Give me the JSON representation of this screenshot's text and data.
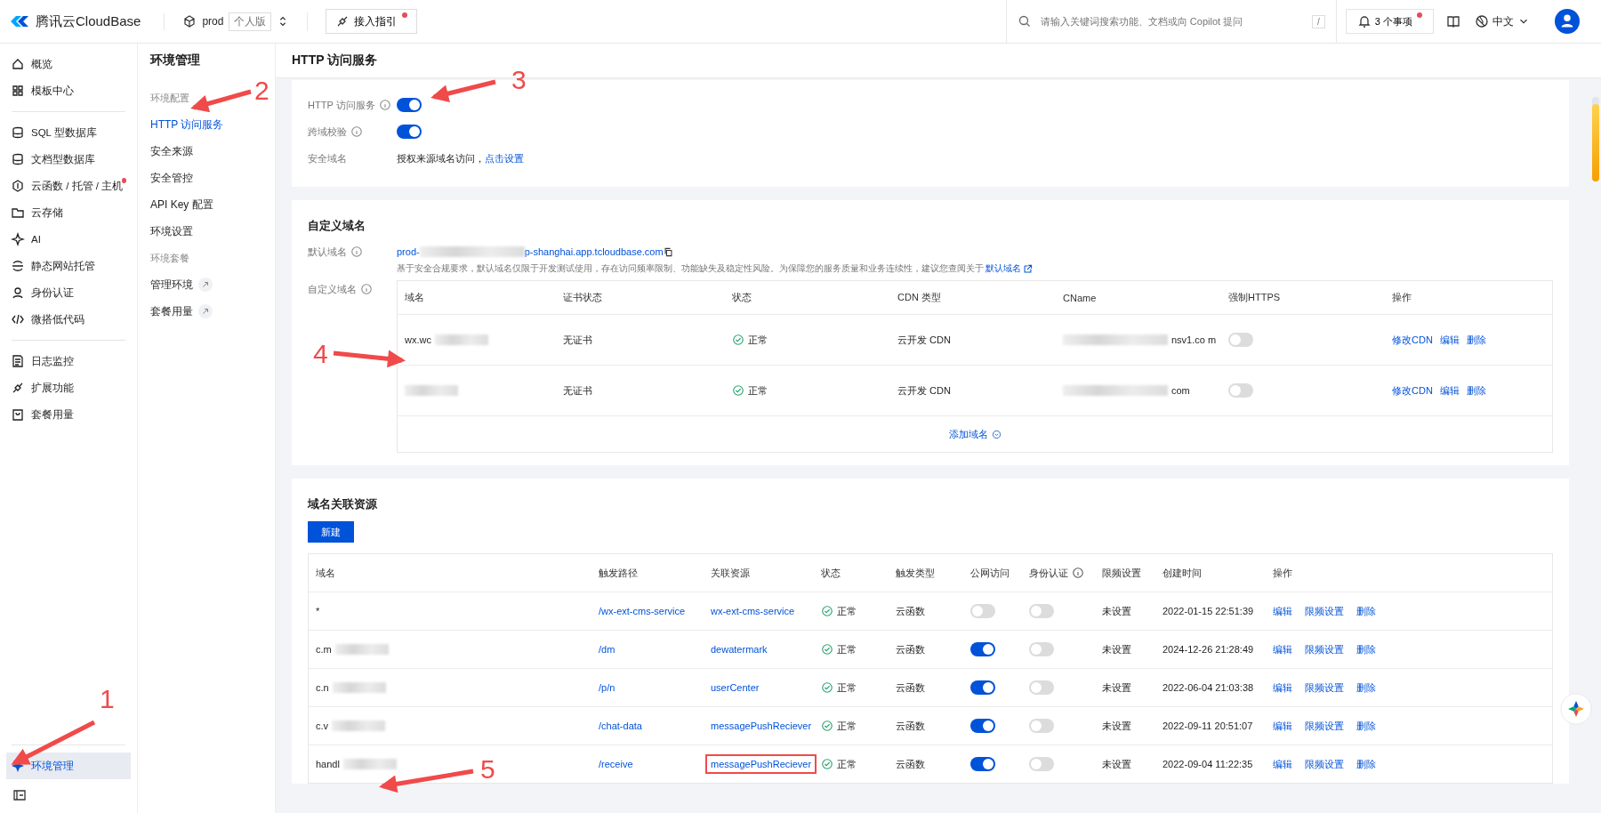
{
  "topbar": {
    "brand": "腾讯云CloudBase",
    "env": "prod",
    "plan": "个人版",
    "guide": "接入指引",
    "search": {
      "placeholder": "请输入关键词搜索功能、文档或向 Copilot 提问",
      "shortcut": "/"
    },
    "notices": "3 个事项",
    "language": "中文"
  },
  "sidebar": {
    "groups": [
      {
        "items": [
          {
            "label": "概览",
            "selected": false,
            "dot": false
          },
          {
            "label": "模板中心",
            "selected": false,
            "dot": false
          }
        ]
      },
      {
        "items": [
          {
            "label": "SQL 型数据库",
            "selected": false,
            "dot": false
          },
          {
            "label": "文档型数据库",
            "selected": false,
            "dot": false
          },
          {
            "label": "云函数 / 托管 / 主机",
            "selected": false,
            "dot": true
          },
          {
            "label": "云存储",
            "selected": false,
            "dot": false
          },
          {
            "label": "AI",
            "selected": false,
            "dot": false
          },
          {
            "label": "静态网站托管",
            "selected": false,
            "dot": false
          },
          {
            "label": "身份认证",
            "selected": false,
            "dot": false
          },
          {
            "label": "微搭低代码",
            "selected": false,
            "dot": false
          }
        ]
      },
      {
        "items": [
          {
            "label": "日志监控",
            "selected": false,
            "dot": false
          },
          {
            "label": "扩展功能",
            "selected": false,
            "dot": false
          },
          {
            "label": "套餐用量",
            "selected": false,
            "dot": false
          }
        ]
      }
    ],
    "footer": {
      "label": "环境管理",
      "selected": true
    }
  },
  "subnav": {
    "title": "环境管理",
    "items": [
      {
        "kind": "heading",
        "label": "环境配置"
      },
      {
        "kind": "link",
        "label": "HTTP 访问服务",
        "selected": true,
        "external": false
      },
      {
        "kind": "link",
        "label": "安全来源",
        "selected": false,
        "external": false
      },
      {
        "kind": "link",
        "label": "安全管控",
        "selected": false,
        "external": false
      },
      {
        "kind": "link",
        "label": "API Key 配置",
        "selected": false,
        "external": false
      },
      {
        "kind": "link",
        "label": "环境设置",
        "selected": false,
        "external": false
      },
      {
        "kind": "heading",
        "label": "环境套餐"
      },
      {
        "kind": "link",
        "label": "管理环境",
        "selected": false,
        "external": true
      },
      {
        "kind": "link",
        "label": "套餐用量",
        "selected": false,
        "external": true
      }
    ]
  },
  "page_title": "HTTP 访问服务",
  "http_settings": [
    {
      "kind": "toggle",
      "label": "HTTP 访问服务",
      "info": true,
      "on": true
    },
    {
      "kind": "toggle",
      "label": "跨域校验",
      "info": true,
      "on": true
    },
    {
      "kind": "text",
      "label": "安全域名",
      "info": false,
      "text": "授权来源域名访问，",
      "link": "点击设置"
    }
  ],
  "custom_domain": {
    "title": "自定义域名",
    "default_label": "默认域名",
    "default_prefix": "prod-",
    "default_suffix": "p-shanghai.app.tcloudbase.com",
    "note": "基于安全合规要求，默认域名仅限于开发测试使用，存在访问频率限制、功能缺失及稳定性风险。为保障您的服务质量和业务连续性，建议您查阅关于",
    "note_link": "默认域名",
    "custom_label": "自定义域名",
    "columns": [
      "域名",
      "证书状态",
      "状态",
      "CDN 类型",
      "CName",
      "强制HTTPS",
      "操作"
    ],
    "rows": [
      {
        "domain": "wx.wc",
        "cert": "无证书",
        "status": "正常",
        "cdn": "云开发 CDN",
        "cname": "nsv1.co m",
        "https": false,
        "actions": [
          "修改CDN",
          "编辑",
          "删除"
        ]
      },
      {
        "domain": "",
        "cert": "无证书",
        "status": "正常",
        "cdn": "云开发 CDN",
        "cname": "com",
        "https": false,
        "actions": [
          "修改CDN",
          "编辑",
          "删除"
        ]
      }
    ],
    "add": "添加域名"
  },
  "resources": {
    "title": "域名关联资源",
    "new_button": "新建",
    "columns": [
      "域名",
      "触发路径",
      "关联资源",
      "状态",
      "触发类型",
      "公网访问",
      "身份认证",
      "限频设置",
      "创建时间",
      "操作"
    ],
    "rows": [
      {
        "domain": "*",
        "blurred": false,
        "path": "/wx-ext-cms-service",
        "resource": "wx-ext-cms-service",
        "status": "正常",
        "type": "云函数",
        "public": false,
        "auth": false,
        "limit": "未设置",
        "created": "2022-01-15 22:51:39",
        "actions": [
          "编辑",
          "限频设置",
          "删除"
        ],
        "highlighted": false
      },
      {
        "domain": "c.m",
        "blurred": true,
        "path": "/dm",
        "resource": "dewatermark",
        "status": "正常",
        "type": "云函数",
        "public": true,
        "auth": false,
        "limit": "未设置",
        "created": "2024-12-26 21:28:49",
        "actions": [
          "编辑",
          "限频设置",
          "删除"
        ],
        "highlighted": false
      },
      {
        "domain": "c.n",
        "blurred": true,
        "path": "/p/n",
        "resource": "userCenter",
        "status": "正常",
        "type": "云函数",
        "public": true,
        "auth": false,
        "limit": "未设置",
        "created": "2022-06-04 21:03:38",
        "actions": [
          "编辑",
          "限频设置",
          "删除"
        ],
        "highlighted": false
      },
      {
        "domain": "c.v",
        "blurred": true,
        "path": "/chat-data",
        "resource": "messagePushReciever",
        "status": "正常",
        "type": "云函数",
        "public": true,
        "auth": false,
        "limit": "未设置",
        "created": "2022-09-11 20:51:07",
        "actions": [
          "编辑",
          "限频设置",
          "删除"
        ],
        "highlighted": false
      },
      {
        "domain": "handl",
        "blurred": true,
        "path": "/receive",
        "resource": "messagePushReciever",
        "status": "正常",
        "type": "云函数",
        "public": true,
        "auth": false,
        "limit": "未设置",
        "created": "2022-09-04 11:22:35",
        "actions": [
          "编辑",
          "限频设置",
          "删除"
        ],
        "highlighted": true
      }
    ]
  },
  "annotations": [
    {
      "label": "1"
    },
    {
      "label": "2"
    },
    {
      "label": "3"
    },
    {
      "label": "4"
    },
    {
      "label": "5"
    }
  ]
}
